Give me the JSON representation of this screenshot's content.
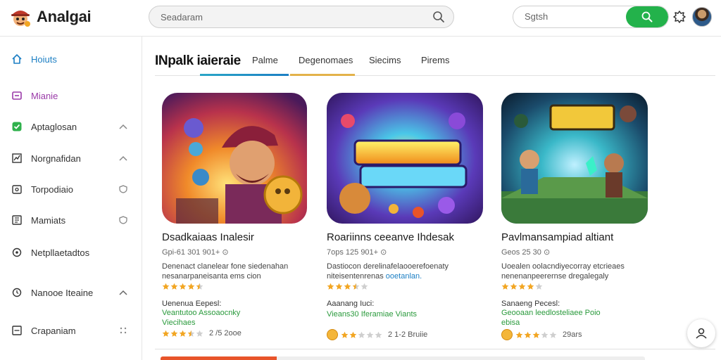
{
  "app": {
    "name": "Analgai"
  },
  "search": {
    "placeholder": "Seadaram"
  },
  "auth": {
    "placeholder": "Sgtsh"
  },
  "sidebar": {
    "items": [
      {
        "label": "Hoiuts",
        "icon": "home-icon"
      },
      {
        "label": "Mianie",
        "icon": "grid-icon"
      },
      {
        "label": "Aptaglosan",
        "icon": "check-badge-icon"
      },
      {
        "label": "Norgnafidan",
        "icon": "chart-icon"
      },
      {
        "label": "Torpodiaio",
        "icon": "tag-icon"
      },
      {
        "label": "Mamiats",
        "icon": "document-icon"
      },
      {
        "label": "Netpllaetadtos",
        "icon": "pin-icon"
      },
      {
        "label": "Nanooe Iteaine",
        "icon": "clock-icon"
      },
      {
        "label": "Crapaniam",
        "icon": "list-icon"
      }
    ]
  },
  "tabs": {
    "title": "INpalk iaieraie",
    "items": [
      "Palme",
      "Degenomaes",
      "Siecims",
      "Pirems"
    ]
  },
  "cards": [
    {
      "title": "Dsadkaiaas Inalesir",
      "meta": "Gpi-61 301 901+",
      "desc_1": "Denenact clanelear fone siedenahan",
      "desc_2": "nesanarpaneisanta ems cion",
      "rating": 4.5,
      "sub_label": "Uenenua Eepesl:",
      "sub_green_1": "Veantutoo Assoaocnky",
      "sub_green_2": "Viecihaes",
      "foot_rating": 3.5,
      "foot_text": "2 /5 2ooe"
    },
    {
      "title": "Roariinns ceeanve Ihdesak",
      "meta": "7ops 125 901+",
      "desc_1": "Dastiocon derelinafelaooerefoenaty",
      "desc_2": "niteisentenrenas",
      "desc_2_hl": "ooetanlan.",
      "rating": 3.5,
      "sub_label": "Aaanang Iuci:",
      "sub_green_1": "Vieans30 Iferamiae Viants",
      "sub_green_2": "",
      "foot_rating": 2,
      "foot_text": "2 1-2 Bruiie"
    },
    {
      "title": "Pavlmansampiad altiant",
      "meta": "Geos 25 30",
      "desc_1": "Uoealen oolacndiyecorray etcrieaes",
      "desc_2": "nenenanpeerernse dregalegaly",
      "rating": 4.0,
      "sub_label": "Sanaeng Pecesl:",
      "sub_green_1": "Geooaan leedlosteliaee Poio",
      "sub_green_2": "ebisa",
      "foot_rating": 3,
      "foot_text": "29ars"
    }
  ],
  "colors": {
    "accent_blue": "#1c7fc4",
    "brand_green": "#23b24b",
    "rating_gold": "#f2a623",
    "link_green": "#2a9a3c"
  }
}
